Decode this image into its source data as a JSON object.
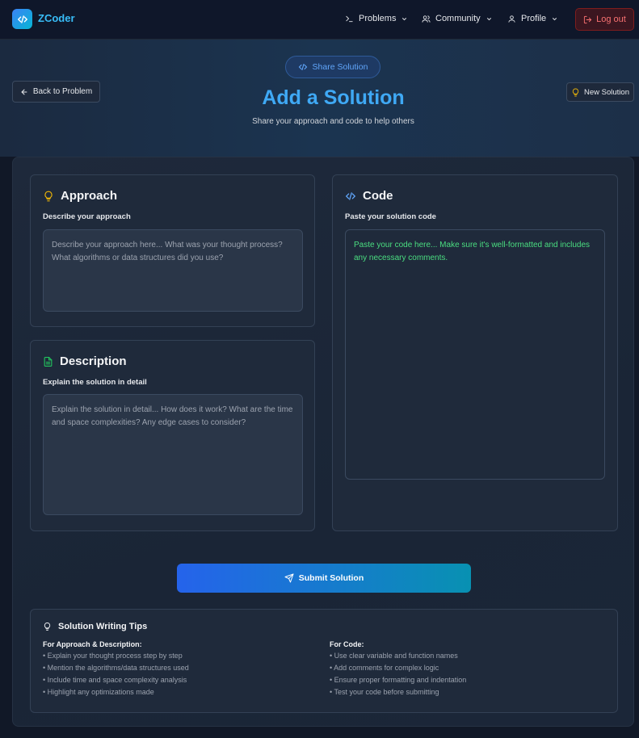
{
  "navbar": {
    "logo": "ZCoder",
    "items": [
      {
        "label": "Problems"
      },
      {
        "label": "Community"
      },
      {
        "label": "Profile"
      }
    ],
    "logout": "Log out"
  },
  "hero": {
    "pill": "Share Solution",
    "title": "Add a Solution",
    "subtitle": "Share your approach and code to help others",
    "back": "Back to Problem",
    "new_solution": "New Solution"
  },
  "approach": {
    "title": "Approach",
    "label": "Describe your approach",
    "placeholder": "Describe your approach here... What was your thought process? What algorithms or data structures did you use?"
  },
  "description": {
    "title": "Description",
    "label": "Explain the solution in detail",
    "placeholder": "Explain the solution in detail... How does it work? What are the time and space complexities? Any edge cases to consider?"
  },
  "code": {
    "title": "Code",
    "label": "Paste your solution code",
    "placeholder": "Paste your code here... Make sure it's well-formatted and includes any necessary comments."
  },
  "submit": "Submit Solution",
  "tips": {
    "title": "Solution Writing Tips",
    "left": {
      "head": "For Approach & Description:",
      "items": [
        "• Explain your thought process step by step",
        "• Mention the algorithms/data structures used",
        "• Include time and space complexity analysis",
        "• Highlight any optimizations made"
      ]
    },
    "right": {
      "head": "For Code:",
      "items": [
        "• Use clear variable and function names",
        "• Add comments for complex logic",
        "• Ensure proper formatting and indentation",
        "• Test your code before submitting"
      ]
    }
  },
  "colors": {
    "accent": "#3fa9f5",
    "danger": "#f87171",
    "success": "#22c55e",
    "warning": "#eab308"
  }
}
